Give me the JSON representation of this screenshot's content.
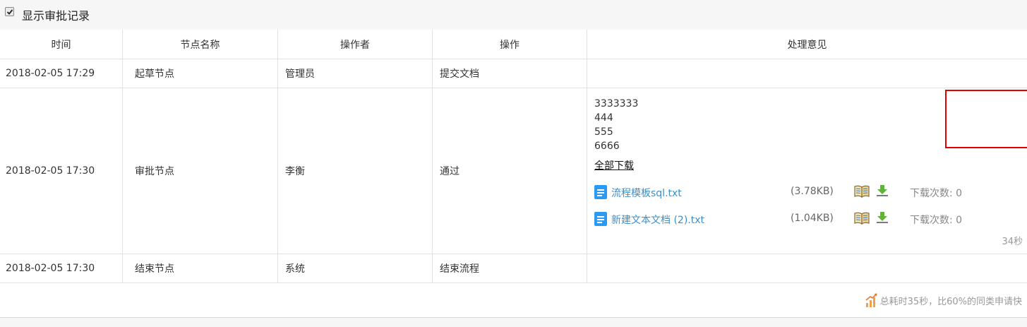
{
  "header": {
    "checkbox_checked": true,
    "title": "显示审批记录"
  },
  "table": {
    "columns": [
      "时间",
      "节点名称",
      "操作者",
      "操作",
      "处理意见"
    ],
    "rows": [
      {
        "time": "2018-02-05 17:29",
        "node": "起草节点",
        "operator": "管理员",
        "action": "提交文档",
        "opinion": ""
      },
      {
        "time": "2018-02-05 17:30",
        "node": "审批节点",
        "operator": "李衡",
        "action": "通过"
      },
      {
        "time": "2018-02-05 17:30",
        "node": "结束节点",
        "operator": "系统",
        "action": "结束流程",
        "opinion": ""
      }
    ],
    "opinion_lines": [
      "3333333",
      "444",
      "555",
      "6666"
    ],
    "download_all": "全部下载",
    "attachments": [
      {
        "name": "流程模板sql.txt",
        "size": "(3.78KB)",
        "download_count": "下载次数: 0",
        "icon": "text-file-icon"
      },
      {
        "name": "新建文本文档 (2).txt",
        "size": "(1.04KB)",
        "download_count": "下载次数: 0",
        "icon": "text-file-icon"
      }
    ],
    "elapsed": "34秒"
  },
  "footer": {
    "summary": "总耗时35秒，比60%的同类申请快",
    "icon": "trend-chart-icon"
  },
  "colors": {
    "link": "#3d8fc8",
    "file_icon": "#2b9af3",
    "highlight_box": "#e00000",
    "muted": "#999999"
  }
}
